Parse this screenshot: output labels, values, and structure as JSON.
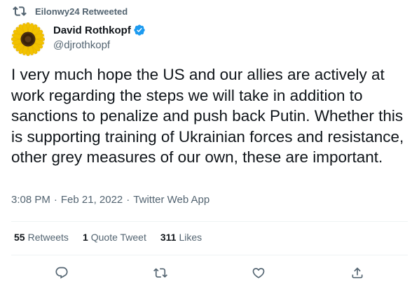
{
  "retweet_banner": {
    "icon": "retweet-icon",
    "text": "Eilonwy24 Retweeted"
  },
  "author": {
    "name": "David Rothkopf",
    "handle": "@djrothkopf",
    "verified": true,
    "avatar": "sunflower"
  },
  "tweet": {
    "text": "I very much hope the US and our allies are actively at work regarding the steps we will take in addition to sanctions to penalize and push back Putin. Whether this is supporting training of Ukrainian forces and resistance, other grey measures of our own, these are important."
  },
  "meta": {
    "time": "3:08 PM",
    "separator": "·",
    "date": "Feb 21, 2022",
    "source": "Twitter Web App"
  },
  "stats": {
    "retweets_count": "55",
    "retweets_label": "Retweets",
    "quotes_count": "1",
    "quotes_label": "Quote Tweet",
    "likes_count": "311",
    "likes_label": "Likes"
  },
  "actions": [
    {
      "name": "reply",
      "icon": "reply-icon"
    },
    {
      "name": "retweet",
      "icon": "retweet-icon"
    },
    {
      "name": "like",
      "icon": "heart-icon"
    },
    {
      "name": "share",
      "icon": "share-icon"
    }
  ],
  "colors": {
    "text_primary": "#0f1419",
    "text_secondary": "#536471",
    "verified_blue": "#1d9bf0",
    "divider": "#eff3f4"
  }
}
